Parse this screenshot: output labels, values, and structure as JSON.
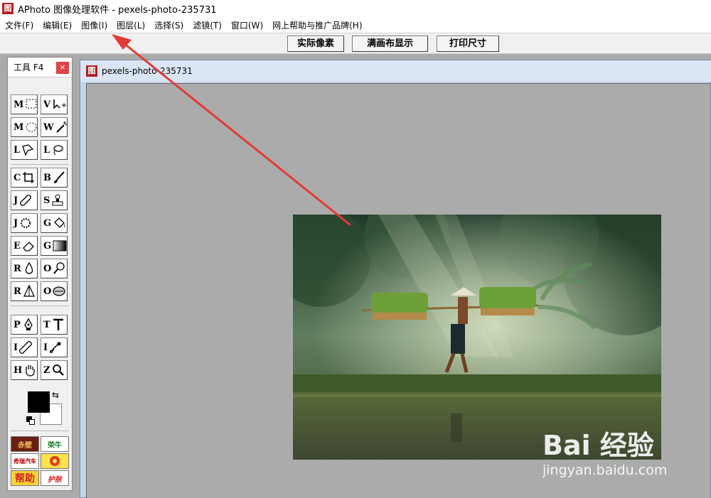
{
  "window": {
    "title": "APhoto 图像处理软件 - pexels-photo-235731",
    "icon": "图"
  },
  "menu": {
    "items": [
      "文件(F)",
      "编辑(E)",
      "图像(I)",
      "图层(L)",
      "选择(S)",
      "滤镜(T)",
      "窗口(W)",
      "网上帮助与推广品牌(H)"
    ]
  },
  "toolbar": {
    "actual_pixels": "实际像素",
    "fit_canvas": "满画布显示",
    "print_size": "打印尺寸"
  },
  "toolpanel": {
    "title": "工具 F4",
    "close": "×",
    "tools": [
      {
        "key": "M",
        "icon": "rect-marquee-icon"
      },
      {
        "key": "V",
        "icon": "move-icon"
      },
      {
        "key": "M",
        "icon": "ellipse-marquee-icon"
      },
      {
        "key": "W",
        "icon": "magic-wand-icon"
      },
      {
        "key": "L",
        "icon": "polygon-lasso-icon"
      },
      {
        "key": "L",
        "icon": "lasso-icon"
      },
      {
        "key": "C",
        "icon": "crop-icon"
      },
      {
        "key": "B",
        "icon": "brush-icon"
      },
      {
        "key": "J",
        "icon": "healing-icon"
      },
      {
        "key": "S",
        "icon": "stamp-icon"
      },
      {
        "key": "J",
        "icon": "spot-icon"
      },
      {
        "key": "G",
        "icon": "bucket-icon"
      },
      {
        "key": "E",
        "icon": "eraser-icon"
      },
      {
        "key": "G",
        "icon": "gradient-icon"
      },
      {
        "key": "R",
        "icon": "blur-icon"
      },
      {
        "key": "O",
        "icon": "dodge-icon"
      },
      {
        "key": "R",
        "icon": "sharpen-icon"
      },
      {
        "key": "O",
        "icon": "sponge-icon"
      },
      {
        "key": "P",
        "icon": "pen-icon"
      },
      {
        "key": "T",
        "icon": "text-icon"
      },
      {
        "key": "I",
        "icon": "ruler-icon"
      },
      {
        "key": "I",
        "icon": "eyedropper-icon"
      },
      {
        "key": "H",
        "icon": "hand-icon"
      },
      {
        "key": "Z",
        "icon": "zoom-icon"
      }
    ],
    "ads": [
      "赤壁",
      "荣牛",
      "奇瑞汽车",
      "",
      "帮助",
      "护肤"
    ]
  },
  "document": {
    "title": "pexels-photo-235731",
    "icon": "图"
  },
  "watermark": {
    "brand": "Bai 经验",
    "url": "jingyan.baidu.com"
  },
  "colors": {
    "accent": "#e53935",
    "fg_swatch": "#000000",
    "bg_swatch": "#ffffff"
  }
}
